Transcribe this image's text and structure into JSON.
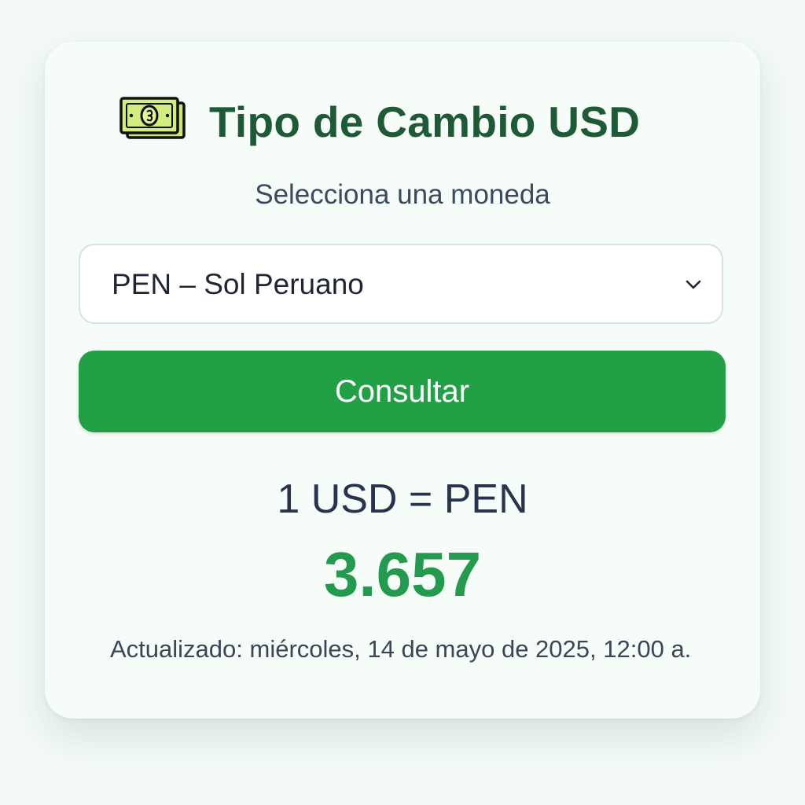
{
  "app": {
    "title": "Tipo de Cambio USD",
    "title_icon": "money-bill-icon",
    "subtitle": "Selecciona una moneda"
  },
  "currency_select": {
    "selected": "PEN – Sol Peruano",
    "icon": "chevron-down-icon"
  },
  "consult_button": {
    "label": "Consultar"
  },
  "result": {
    "pair_label": "1 USD = PEN",
    "rate": "3.657",
    "updated": "Actualizado: miércoles, 14 de mayo de 2025, 12:00 a."
  },
  "colors": {
    "accent": "#21a046",
    "title": "#1f5a36",
    "rate": "#249a4e",
    "card_background": "#f6fcf7"
  }
}
